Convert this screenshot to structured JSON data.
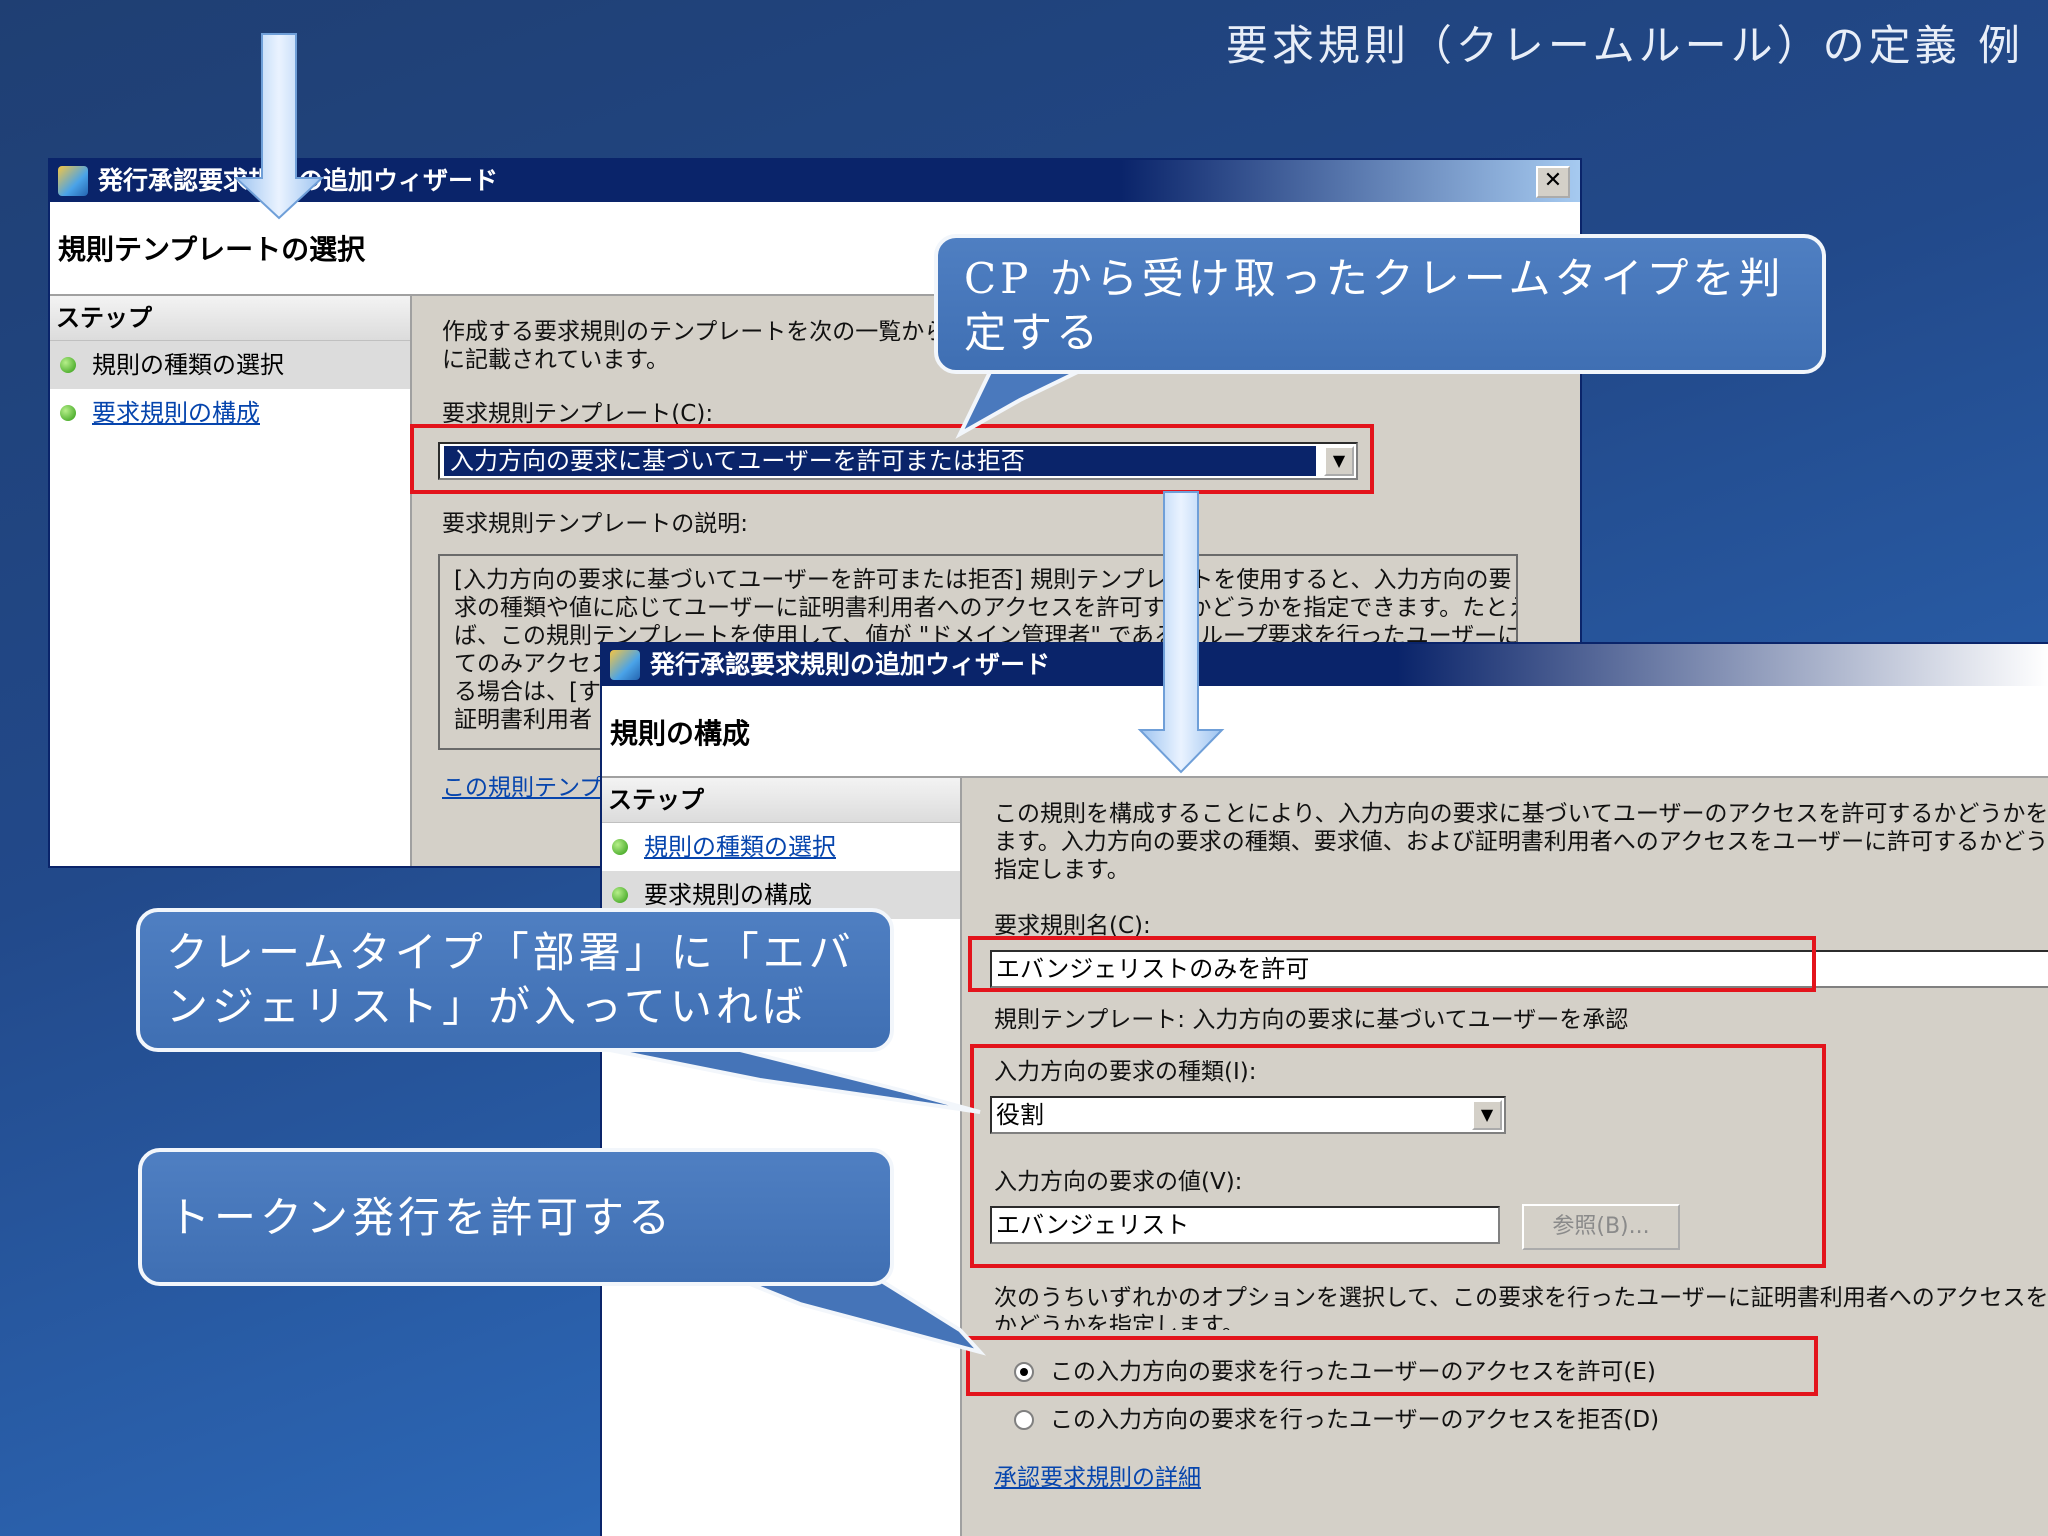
{
  "slide": {
    "title": "要求規則（クレームルール）の定義 例"
  },
  "wizard1": {
    "title": "発行承認要求規則の追加ウィザード",
    "header": "規則テンプレートの選択",
    "steps_header": "ステップ",
    "steps": [
      "規則の種類の選択",
      "要求規則の構成"
    ],
    "intro": "作成する要求規則のテンプレートを次の一覧から選",
    "intro2": "に記載されています。",
    "template_label": "要求規則テンプレート(C):",
    "template_value": "入力方向の要求に基づいてユーザーを許可または拒否",
    "desc_label": "要求規則テンプレートの説明:",
    "desc_lines": [
      "[入力方向の要求に基づいてユーザーを許可または拒否] 規則テンプレートを使用すると、入力方向の要",
      "求の種類や値に応じてユーザーに証明書利用者へのアクセスを許可するかどうかを指定できます。たとえ",
      "ば、この規則テンプレートを使用して、値が \"ドメイン管理者\" であるグループ要求を行ったユーザーに対し",
      "てのみアクセス",
      "る場合は、[す",
      "証明書利用者"
    ],
    "help_link": "この規則テンプレ"
  },
  "wizard2": {
    "title": "発行承認要求規則の追加ウィザード",
    "header": "規則の構成",
    "steps_header": "ステップ",
    "steps": [
      "規則の種類の選択",
      "要求規則の構成"
    ],
    "intro_lines": [
      "この規則を構成することにより、入力方向の要求に基づいてユーザーのアクセスを許可するかどうかを指定で",
      "ます。入力方向の要求の種類、要求値、および証明書利用者へのアクセスをユーザーに許可するかどうか",
      "指定します。"
    ],
    "rule_name_label": "要求規則名(C):",
    "rule_name_value": "エバンジェリストのみを許可",
    "template_line": "規則テンプレート: 入力方向の要求に基づいてユーザーを承認",
    "claim_type_label": "入力方向の要求の種類(I):",
    "claim_type_value": "役割",
    "claim_value_label": "入力方向の要求の値(V):",
    "claim_value_value": "エバンジェリスト",
    "browse_button": "参照(B)...",
    "option_intro_lines": [
      "次のうちいずれかのオプションを選択して、この要求を行ったユーザーに証明書利用者へのアクセスを許可す",
      "かどうかを指定します。"
    ],
    "option_permit": "この入力方向の要求を行ったユーザーのアクセスを許可(E)",
    "option_deny": "この入力方向の要求を行ったユーザーのアクセスを拒否(D)",
    "details_link": "承認要求規則の詳細"
  },
  "callouts": {
    "c1": [
      "CP から受け取ったクレームタイプを判",
      "定する"
    ],
    "c2": [
      "クレームタイプ「部署」に「エバ",
      "ンジェリスト」が入っていれば"
    ],
    "c3": [
      "トークン発行を許可する"
    ]
  },
  "colors": {
    "highlight": "#e3141c",
    "callout": "#4a79bd",
    "titlebar": "#0a246a"
  }
}
